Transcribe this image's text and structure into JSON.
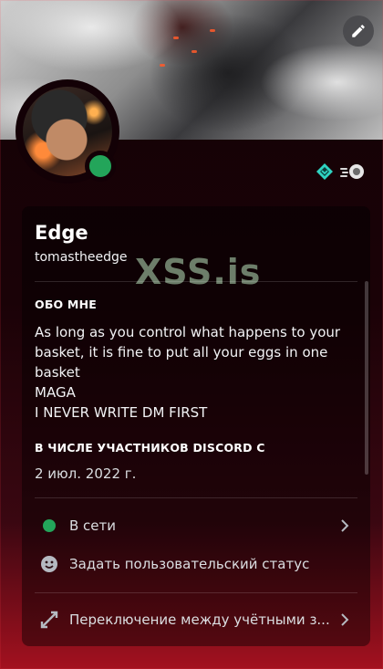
{
  "profile": {
    "display_name": "Edge",
    "username": "tomastheedge",
    "watermark": "XSS.is",
    "status": "online",
    "colors": {
      "online": "#23a55a",
      "accent": "#a3111f",
      "badge_gem": "#2fd3c1"
    }
  },
  "icons": {
    "edit": "pencil-icon",
    "badge_1": "gem-badge-icon",
    "badge_2": "speed-orb-badge-icon",
    "online": "online-dot-icon",
    "custom_status": "smiley-icon",
    "switch": "switch-accounts-icon",
    "chevron": "chevron-right-icon"
  },
  "about": {
    "title": "ОБО МНЕ",
    "lines": [
      "As long as you control what happens to your",
      "basket, it is fine to put all your eggs in one",
      "basket",
      "MAGA",
      "I NEVER WRITE DM FIRST"
    ]
  },
  "member_since": {
    "title": "В ЧИСЛЕ УЧАСТНИКОВ DISCORD С",
    "date": "2 июл. 2022 г."
  },
  "menu": {
    "online_label": "В сети",
    "custom_status_label": "Задать пользовательский статус",
    "switch_accounts_label": "Переключение между учётными з..."
  }
}
